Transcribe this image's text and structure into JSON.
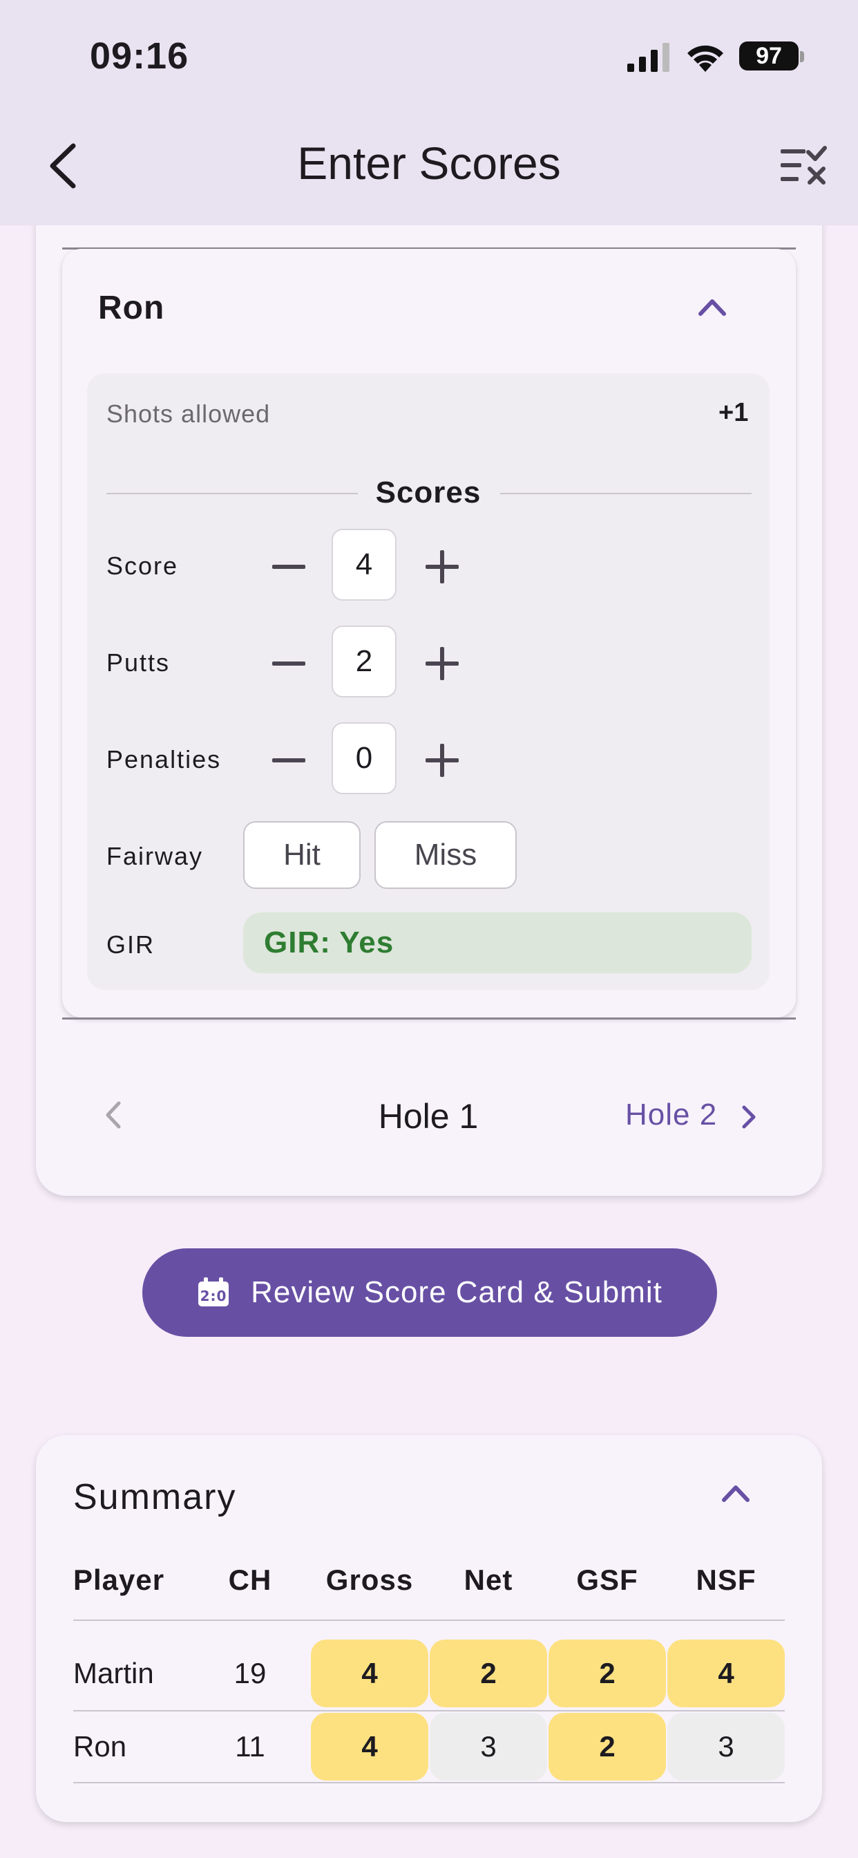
{
  "status_bar": {
    "time": "09:16",
    "battery": "97"
  },
  "app_bar": {
    "title": "Enter Scores"
  },
  "player_card": {
    "player_name": "Ron",
    "shots_allowed_label": "Shots allowed",
    "shots_allowed_value": "+1",
    "scores_heading": "Scores",
    "rows": [
      {
        "label": "Score",
        "value": "4"
      },
      {
        "label": "Putts",
        "value": "2"
      },
      {
        "label": "Penalties",
        "value": "0"
      }
    ],
    "fairway": {
      "label": "Fairway",
      "hit": "Hit",
      "miss": "Miss"
    },
    "gir": {
      "label": "GIR",
      "value": "GIR: Yes"
    }
  },
  "hole_nav": {
    "current": "Hole 1",
    "next": "Hole 2"
  },
  "review_button": "Review Score Card & Submit",
  "summary": {
    "title": "Summary",
    "headers": [
      "Player",
      "CH",
      "Gross",
      "Net",
      "GSF",
      "NSF"
    ],
    "rows": [
      {
        "player": "Martin",
        "ch": "19",
        "gross": "4",
        "net": "2",
        "gsf": "2",
        "nsf": "4"
      },
      {
        "player": "Ron",
        "ch": "11",
        "gross": "4",
        "net": "3",
        "gsf": "2",
        "nsf": "3"
      }
    ]
  },
  "colors": {
    "accent": "#6750a4",
    "highlight": "#fde181",
    "gir_green": "#2e7d32"
  }
}
